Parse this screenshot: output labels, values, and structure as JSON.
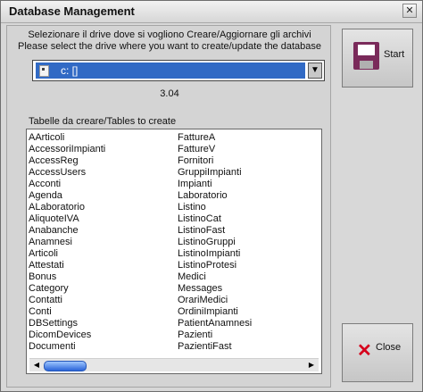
{
  "window": {
    "title": "Database Management",
    "close_glyph": "✕"
  },
  "instructions": {
    "line_it": "Selezionare il drive dove si vogliono Creare/Aggiornare gli archivi",
    "line_en": "Please select the drive where you want to create/update the database"
  },
  "drive": {
    "selected": "c: []",
    "arrow": "▼"
  },
  "version": "3.04",
  "tables_label": "Tabelle da creare/Tables to create",
  "tables": {
    "column1": [
      "AArticoli",
      "AccessoriImpianti",
      "AccessReg",
      "AccessUsers",
      "Acconti",
      "Agenda",
      "ALaboratorio",
      "AliquoteIVA",
      "Anabanche",
      "Anamnesi",
      "Articoli",
      "Attestati",
      "Bonus",
      "Category",
      "Contatti",
      "Conti",
      "DBSettings",
      "DicomDevices",
      "Documenti"
    ],
    "column2": [
      "FattureA",
      "FattureV",
      "Fornitori",
      "GruppiImpianti",
      "Impianti",
      "Laboratorio",
      "Listino",
      "ListinoCat",
      "ListinoFast",
      "ListinoGruppi",
      "ListinoImpianti",
      "ListinoProtesi",
      "Medici",
      "Messages",
      "OrariMedici",
      "OrdiniImpianti",
      "PatientAnamnesi",
      "Pazienti",
      "PazientiFast"
    ]
  },
  "scrollbar": {
    "left_glyph": "◀",
    "right_glyph": "▶"
  },
  "buttons": {
    "start_label": "Start",
    "close_label": "Close",
    "close_glyph": "✕"
  },
  "icons": {
    "start": "floppy-disk-icon",
    "close": "red-x-icon"
  }
}
